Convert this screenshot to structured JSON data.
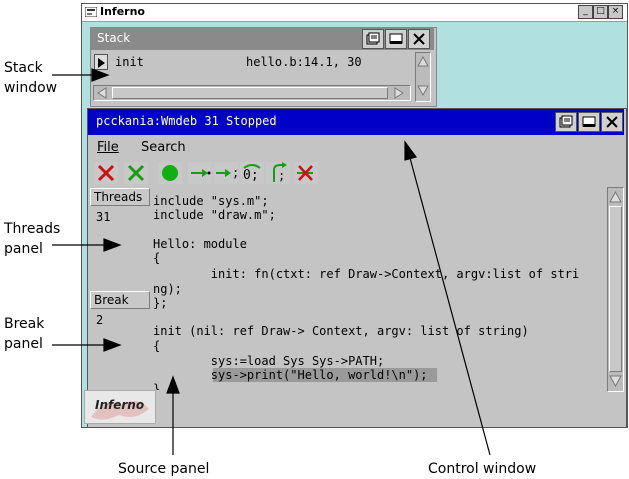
{
  "outer_window": {
    "title": "Inferno",
    "buttons": [
      "_",
      "□",
      "×"
    ]
  },
  "stack_window": {
    "title": "Stack",
    "row": {
      "name": "init",
      "location": "hello.b:14.1, 30"
    }
  },
  "control_window": {
    "title": "pcckania:Wmdeb 31 Stopped",
    "menu": [
      "File",
      "Search"
    ]
  },
  "threads_panel": {
    "label": "Threads",
    "value": "31"
  },
  "break_panel": {
    "label": "Break",
    "value": "2"
  },
  "source_lines": [
    "include \"sys.m\";",
    "include \"draw.m\";",
    "",
    "Hello: module",
    "{",
    "        init: fn(ctxt: ref Draw->Context, argv:list of stri",
    "ng);",
    "};",
    "",
    "init (nil: ref Draw-> Context, argv: list of string)",
    "{",
    "        sys:=load Sys Sys->PATH;",
    "        sys->print(\"Hello, world!\\n\");",
    "}"
  ],
  "logo_text": "Inferno",
  "annotations": {
    "stack": [
      "Stack",
      "window"
    ],
    "threads": [
      "Threads",
      "panel"
    ],
    "break": [
      "Break",
      "panel"
    ],
    "source": "Source panel",
    "control": "Control window"
  }
}
